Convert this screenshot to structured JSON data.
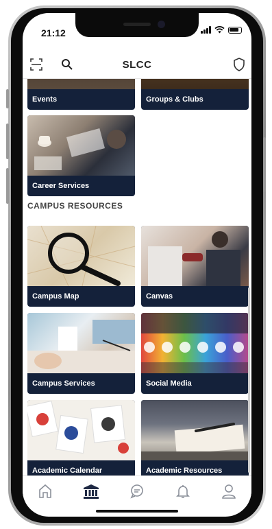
{
  "status_bar": {
    "time": "21:12"
  },
  "header": {
    "title": "SLCC"
  },
  "tiles_top": [
    {
      "label": "Events"
    },
    {
      "label": "Groups & Clubs"
    },
    {
      "label": "Career Services"
    }
  ],
  "section": {
    "title": "CAMPUS RESOURCES"
  },
  "resources": [
    {
      "label": "Campus Map"
    },
    {
      "label": "Canvas"
    },
    {
      "label": "Campus Services"
    },
    {
      "label": "Social Media"
    },
    {
      "label": "Academic Calendar"
    },
    {
      "label": "Academic Resources"
    }
  ],
  "tabbar": {
    "items": [
      {
        "icon": "home-icon"
      },
      {
        "icon": "institution-icon",
        "active": true
      },
      {
        "icon": "chat-icon"
      },
      {
        "icon": "bell-icon"
      },
      {
        "icon": "user-icon"
      }
    ]
  },
  "colors": {
    "tile_bg": "#14213a",
    "active_tab": "#1f2a44"
  }
}
